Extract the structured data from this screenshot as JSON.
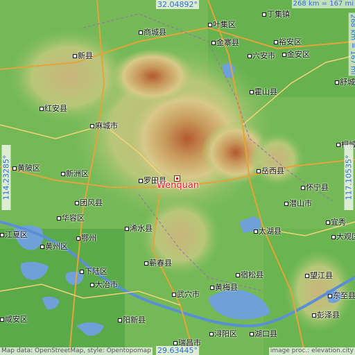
{
  "place": "Wenquan",
  "coords": {
    "top": "32.04892°",
    "bottom": "29.63445°",
    "left": "114.23285°",
    "right": "117.10535°"
  },
  "scale": {
    "top": "268 km = 167 mi",
    "right": "268 km = 167 mi"
  },
  "attribution": {
    "left": "Map data: OpenStreetMap, style: Opentopomap",
    "right": "image proc.: elevation.city"
  },
  "cities": [
    {
      "label": "商城县"
    },
    {
      "label": "叶集区"
    },
    {
      "label": "金寨县"
    },
    {
      "label": "裕安区"
    },
    {
      "label": "六安市"
    },
    {
      "label": "金安区"
    },
    {
      "label": "新县"
    },
    {
      "label": "霍山县"
    },
    {
      "label": "舒城"
    },
    {
      "label": "红安县"
    },
    {
      "label": "麻城市"
    },
    {
      "label": "岳西县"
    },
    {
      "label": "黄陂区"
    },
    {
      "label": "新洲区"
    },
    {
      "label": "罗田县"
    },
    {
      "label": "怀宁县"
    },
    {
      "label": "团风县"
    },
    {
      "label": "潜山市"
    },
    {
      "label": "华容区"
    },
    {
      "label": "浠水县"
    },
    {
      "label": "太湖县"
    },
    {
      "label": "鄂州"
    },
    {
      "label": "黄州区"
    },
    {
      "label": "蕲春县"
    },
    {
      "label": "下陆区"
    },
    {
      "label": "大冶市"
    },
    {
      "label": "宿松县"
    },
    {
      "label": "望江县"
    },
    {
      "label": "黄梅县"
    },
    {
      "label": "武穴市"
    },
    {
      "label": "阳新县"
    },
    {
      "label": "浔阳区"
    },
    {
      "label": "湖口县"
    },
    {
      "label": "彭泽县"
    },
    {
      "label": "瑞昌市"
    },
    {
      "label": "咸安区"
    },
    {
      "label": "江夏区"
    },
    {
      "label": "丁集镇"
    },
    {
      "label": "桐城"
    },
    {
      "label": "宜秀"
    },
    {
      "label": "大观区"
    },
    {
      "label": "东至县"
    }
  ]
}
